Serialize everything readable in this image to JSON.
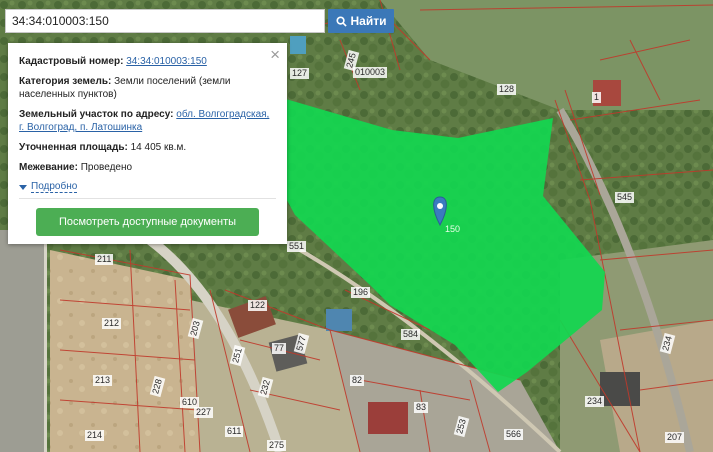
{
  "search": {
    "value": "34:34:010003:150",
    "button_label": "Найти"
  },
  "info": {
    "cadastral_label": "Кадастровый номер:",
    "cadastral_value": "34:34:010003:150",
    "category_label": "Категория земель:",
    "category_value": "Земли поселений (земли населенных пунктов)",
    "address_label": "Земельный участок по адресу:",
    "address_value": "обл. Волгоградская, г. Волгоград, п. Латошинка",
    "area_label": "Уточненная площадь:",
    "area_value": "14 405 кв.м.",
    "survey_label": "Межевание:",
    "survey_value": "Проведено",
    "more_link": "Подробно",
    "docs_button": "Посмотреть доступные документы",
    "close_symbol": "×"
  },
  "map": {
    "labels": [
      "127",
      "245",
      "010003",
      "128",
      "1",
      "545",
      "551",
      "211",
      "196",
      "122",
      "212",
      "577",
      "584",
      "203",
      "77",
      "251",
      "213",
      "82",
      "228",
      "610",
      "227",
      "232",
      "83",
      "214",
      "611",
      "275",
      "253",
      "566",
      "234",
      "207",
      "234",
      "150"
    ],
    "polygon_color": "#13d650",
    "marker_color": "#3b7bbf"
  },
  "colors": {
    "accent": "#3b78b8",
    "link": "#2a62a6",
    "button_green": "#4cae54"
  },
  "icons": {
    "search": "search-icon",
    "close": "close-icon",
    "marker": "map-marker-icon",
    "expand": "chevron-down-icon"
  }
}
